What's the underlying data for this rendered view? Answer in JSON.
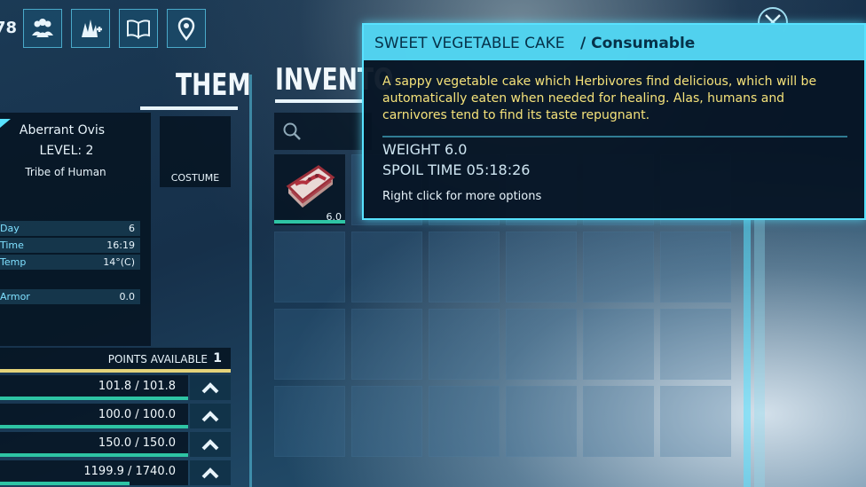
{
  "top_bar": {
    "partial_label": "78",
    "icons": [
      "tribe-icon",
      "dino-icon",
      "engram-icon",
      "map-marker-icon"
    ]
  },
  "left_panel": {
    "section_title": "THEM",
    "creature_name": "Aberrant Ovis",
    "level": "LEVEL: 2",
    "tribe": "Tribe of Human",
    "costume_label": "COSTUME",
    "stats": [
      {
        "label": "Day",
        "value": "6"
      },
      {
        "label": "Time",
        "value": "16:19"
      },
      {
        "label": "Temp",
        "value": "14°(C)"
      },
      {
        "label": "Armor",
        "value": "0.0"
      }
    ],
    "points_label": "POINTS AVAILABLE",
    "points_value": "1",
    "bars": [
      {
        "value": "101.8 / 101.8",
        "fill": 1.0
      },
      {
        "value": "100.0 / 100.0",
        "fill": 1.0
      },
      {
        "value": "150.0 / 150.0",
        "fill": 1.0
      },
      {
        "value": "1199.9 / 1740.0",
        "fill": 0.69
      }
    ]
  },
  "inventory": {
    "title": "INVENTO",
    "item_weight": "6.0",
    "item_icon": "cake-slice-icon"
  },
  "tooltip": {
    "item_name": "SWEET VEGETABLE CAKE",
    "item_type": " / Consumable",
    "description": "A sappy vegetable cake which Herbivores find delicious, which will be automatically eaten when needed for healing. Alas, humans and carnivores tend to find its taste repugnant.",
    "weight": "WEIGHT 6.0",
    "spoil_time": "SPOIL TIME 05:18:26",
    "hint": "Right click for more options"
  },
  "colors": {
    "accent": "#58e2ff",
    "tooltip_text": "#f5e27a",
    "panel_bg": "#061422",
    "bar_fill": "#2ec4a4",
    "points_bar": "#e4d37a"
  }
}
